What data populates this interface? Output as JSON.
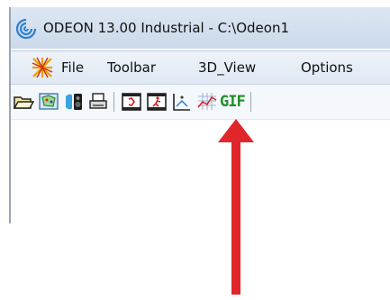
{
  "window": {
    "title": "ODEON 13.00 Industrial  -  C:\\Odeon1"
  },
  "menu": {
    "items": [
      "File",
      "Toolbar",
      "3D_View",
      "Options"
    ]
  },
  "toolbar": {
    "icons": [
      "open-folder-icon",
      "room-view-icon",
      "speaker-icon",
      "print-icon",
      "film-icon",
      "walker-film-icon",
      "walker-icon",
      "grid-plot-icon",
      "gif-icon"
    ],
    "gif_label": "GIF"
  },
  "annotation": {
    "arrow_color": "#e0262b",
    "target": "3D_View"
  }
}
